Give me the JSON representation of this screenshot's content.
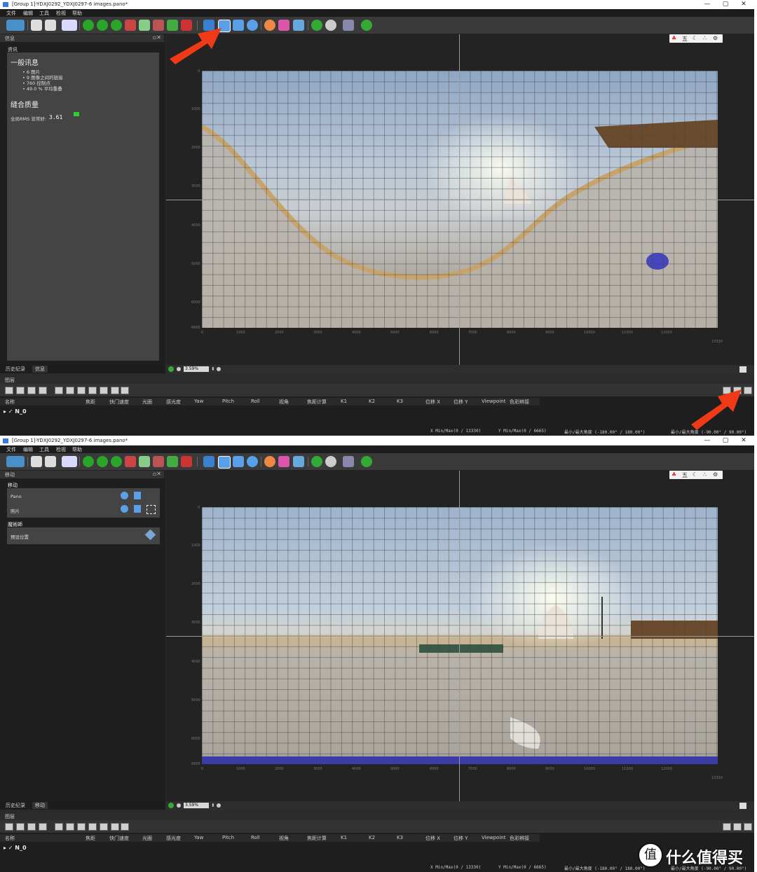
{
  "window": {
    "title": "[Group 1]-YDXJ0292_YDXJ0297-6 images.pano*",
    "controls": [
      "—",
      "▢",
      "✕"
    ]
  },
  "menu": [
    "文件",
    "编辑",
    "工具",
    "检视",
    "帮助"
  ],
  "top_screen": {
    "panel_title": "信息",
    "section_label": "资讯",
    "general_heading": "一般讯息",
    "stats": [
      "6 图片",
      "9 图像之间的链接",
      "760 控制点",
      "49.0 % 平均重叠"
    ],
    "quality_heading": "缝合质量",
    "rms_label": "全局RMS 非常好:",
    "rms_value": "3.61",
    "tabs": [
      "历史纪录",
      "信息"
    ]
  },
  "bottom_screen": {
    "panel_title": "移动",
    "section_label": "移动",
    "rows": [
      "Pano",
      "照片"
    ],
    "wizard_heading": "魔術師",
    "preset_label": "预设位置",
    "tabs": [
      "历史纪录",
      "移动"
    ]
  },
  "viewport": {
    "zoom": "3.59%",
    "y_ticks": [
      "0",
      "1000",
      "2000",
      "3000",
      "4000",
      "5000",
      "6000",
      "6665"
    ],
    "x_ticks": [
      "0",
      "1000",
      "2000",
      "3000",
      "4000",
      "5000",
      "6000",
      "7000",
      "8000",
      "9000",
      "10000",
      "11000",
      "12000",
      "13000"
    ],
    "x_max": "13330",
    "mode_glyph": "五"
  },
  "layers": {
    "title": "图层",
    "columns": [
      "名称",
      "焦距",
      "快门速度",
      "光圈",
      "感光度",
      "Yaw",
      "Pitch",
      "Roll",
      "视角",
      "焦距计算",
      "K1",
      "K2",
      "K3",
      "位移 X",
      "位移 Y",
      "Viewpoint",
      "色彩辨接"
    ],
    "row": "N_0",
    "status": {
      "x": "X Min/Max(0 / 13330)",
      "y": "Y Min/Max(0 / 6665)",
      "yaw": "最小/最大角度 (-180.00° / 180.00°)",
      "pitch": "最小/最大角度 (-90.00° / 90.00°)"
    }
  },
  "watermark": {
    "icon": "值",
    "text": "什么值得买"
  },
  "colors": {
    "accent_arrow": "#f03a17",
    "panel_bg": "#444444",
    "viewport_bg": "#232323"
  }
}
